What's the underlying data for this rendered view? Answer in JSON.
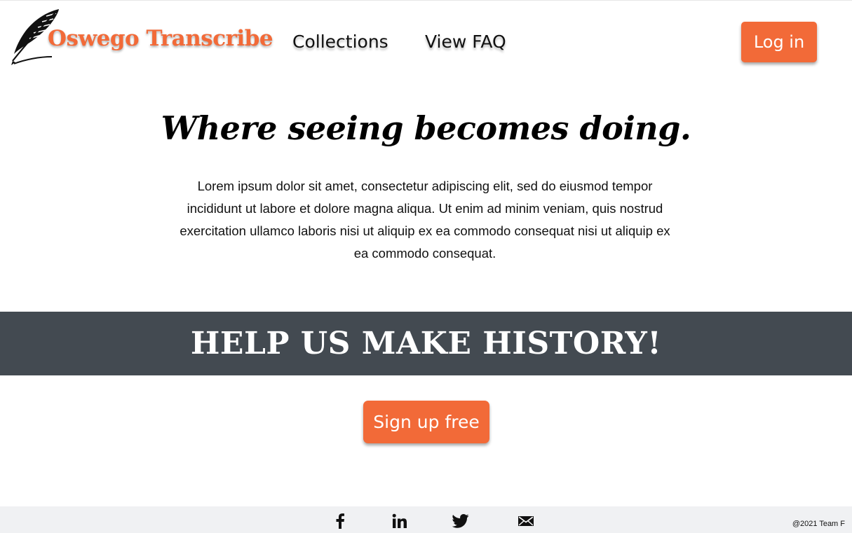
{
  "colors": {
    "accent": "#f26a38",
    "banner_bg": "#434a51",
    "footer_bg": "#f0f1f3",
    "logo_text": "#f26a38"
  },
  "header": {
    "logo_text": "Oswego Transcribe",
    "logo_icon": "quill-icon",
    "nav": {
      "collections": "Collections",
      "faq": "View FAQ"
    },
    "login_label": "Log in"
  },
  "hero": {
    "title": "Where seeing becomes doing.",
    "body": "Lorem ipsum dolor sit amet, consectetur adipiscing elit, sed do eiusmod tempor incididunt ut labore et dolore magna aliqua. Ut enim ad minim veniam, quis nostrud exercitation ullamco laboris nisi ut aliquip ex ea commodo consequat nisi ut aliquip ex ea commodo consequat."
  },
  "banner": {
    "text": "HELP US MAKE HISTORY!"
  },
  "cta": {
    "signup_label": "Sign up free"
  },
  "footer": {
    "social_icons": [
      "facebook-icon",
      "linkedin-icon",
      "twitter-icon",
      "email-icon"
    ],
    "copyright": "@2021 Team F"
  }
}
